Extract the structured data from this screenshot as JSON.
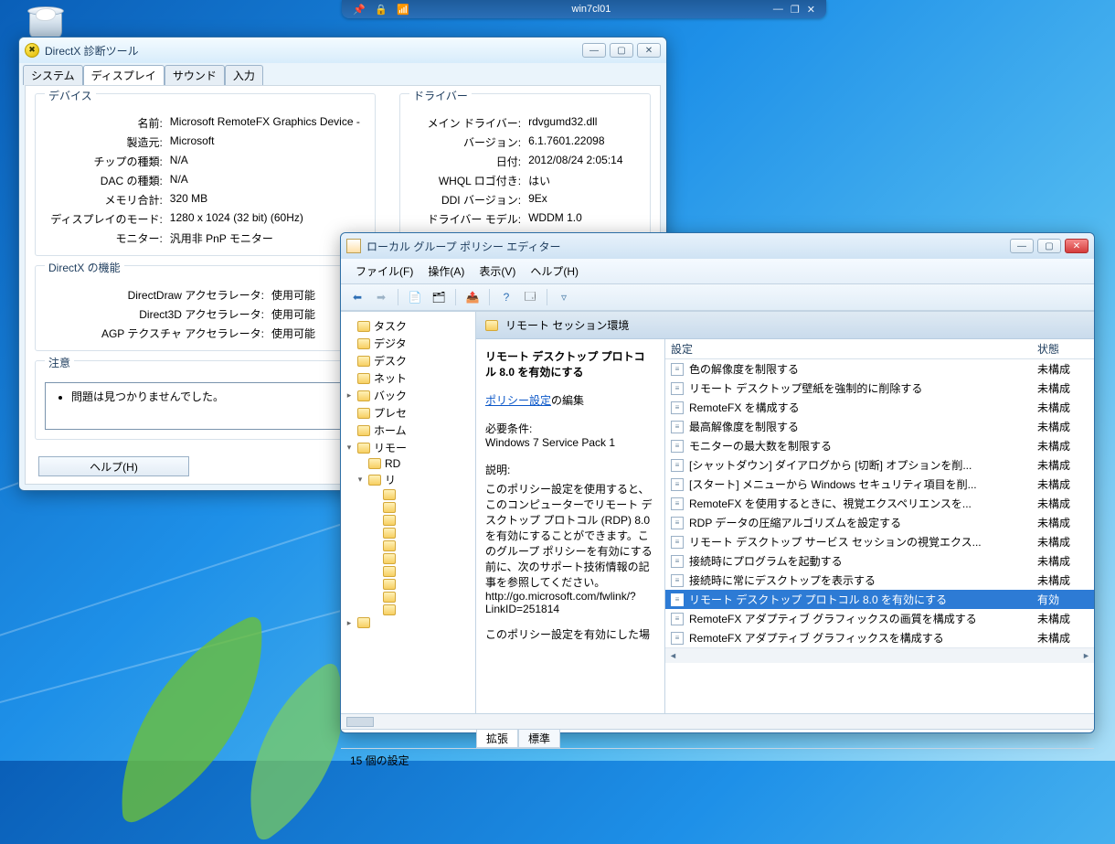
{
  "conn": {
    "title": "win7cl01"
  },
  "dxdiag": {
    "title": "DirectX 診断ツール",
    "tabs": [
      "システム",
      "ディスプレイ",
      "サウンド",
      "入力"
    ],
    "active_tab": 1,
    "device_label": "デバイス",
    "driver_label": "ドライバー",
    "dxfunc_label": "DirectX の機能",
    "notes_label": "注意",
    "device": [
      {
        "k": "名前:",
        "v": "Microsoft RemoteFX Graphics Device -"
      },
      {
        "k": "製造元:",
        "v": "Microsoft"
      },
      {
        "k": "チップの種類:",
        "v": "N/A"
      },
      {
        "k": "DAC の種類:",
        "v": "N/A"
      },
      {
        "k": "メモリ合計:",
        "v": "320 MB"
      },
      {
        "k": "ディスプレイのモード:",
        "v": "1280 x 1024 (32 bit) (60Hz)"
      },
      {
        "k": "モニター:",
        "v": "汎用非 PnP モニター"
      }
    ],
    "driver": [
      {
        "k": "メイン ドライバー:",
        "v": "rdvgumd32.dll"
      },
      {
        "k": "バージョン:",
        "v": "6.1.7601.22098"
      },
      {
        "k": "日付:",
        "v": "2012/08/24 2:05:14"
      },
      {
        "k": "WHQL ロゴ付き:",
        "v": "はい"
      },
      {
        "k": "DDI バージョン:",
        "v": "9Ex"
      },
      {
        "k": "ドライバー モデル:",
        "v": "WDDM 1.0"
      }
    ],
    "dxfunc": [
      {
        "k": "DirectDraw アクセラレータ:",
        "v": "使用可能"
      },
      {
        "k": "Direct3D アクセラレータ:",
        "v": "使用可能"
      },
      {
        "k": "AGP テクスチャ アクセラレータ:",
        "v": "使用可能"
      }
    ],
    "note_text": "問題は見つかりませんでした。",
    "help_btn": "ヘルプ(H)"
  },
  "gpedit": {
    "title": "ローカル グループ ポリシー エディター",
    "menus": [
      "ファイル(F)",
      "操作(A)",
      "表示(V)",
      "ヘルプ(H)"
    ],
    "tree": [
      {
        "indent": 0,
        "exp": "",
        "label": "タスク"
      },
      {
        "indent": 0,
        "exp": "",
        "label": "デジタ"
      },
      {
        "indent": 0,
        "exp": "",
        "label": "デスク"
      },
      {
        "indent": 0,
        "exp": "",
        "label": "ネット"
      },
      {
        "indent": 0,
        "exp": "▸",
        "label": "バック"
      },
      {
        "indent": 0,
        "exp": "",
        "label": "プレセ"
      },
      {
        "indent": 0,
        "exp": "",
        "label": "ホーム"
      },
      {
        "indent": 0,
        "exp": "▾",
        "label": "リモー"
      },
      {
        "indent": 1,
        "exp": "",
        "label": "RD"
      },
      {
        "indent": 1,
        "exp": "▾",
        "label": "リ"
      },
      {
        "indent": 2,
        "exp": "",
        "label": ""
      },
      {
        "indent": 2,
        "exp": "",
        "label": ""
      },
      {
        "indent": 2,
        "exp": "",
        "label": ""
      },
      {
        "indent": 2,
        "exp": "",
        "label": ""
      },
      {
        "indent": 2,
        "exp": "",
        "label": ""
      },
      {
        "indent": 2,
        "exp": "",
        "label": ""
      },
      {
        "indent": 2,
        "exp": "",
        "label": ""
      },
      {
        "indent": 2,
        "exp": "",
        "label": ""
      },
      {
        "indent": 2,
        "exp": "",
        "label": ""
      },
      {
        "indent": 2,
        "exp": "",
        "label": ""
      },
      {
        "indent": 0,
        "exp": "▸",
        "label": ""
      }
    ],
    "detail_header": "リモート セッション環境",
    "selected_policy": "リモート デスクトップ プロトコル 8.0 を有効にする",
    "policy_link": "ポリシー設定",
    "policy_link_suffix": "の編集",
    "req_label": "必要条件:",
    "req_text": "Windows 7 Service Pack 1",
    "desc_label": "説明:",
    "desc_text": "このポリシー設定を使用すると、このコンピューターでリモート デスクトップ プロトコル (RDP) 8.0 を有効にすることができます。このグループ ポリシーを有効にする前に、次のサポート技術情報の記事を参照してください。http://go.microsoft.com/fwlink/?LinkID=251814",
    "desc_text2": "このポリシー設定を有効にした場",
    "col_setting": "設定",
    "col_state": "状態",
    "policies": [
      {
        "name": "色の解像度を制限する",
        "state": "未構成",
        "sel": false
      },
      {
        "name": "リモート デスクトップ壁紙を強制的に削除する",
        "state": "未構成",
        "sel": false
      },
      {
        "name": "RemoteFX を構成する",
        "state": "未構成",
        "sel": false
      },
      {
        "name": "最高解像度を制限する",
        "state": "未構成",
        "sel": false
      },
      {
        "name": "モニターの最大数を制限する",
        "state": "未構成",
        "sel": false
      },
      {
        "name": "[シャットダウン] ダイアログから [切断] オプションを削...",
        "state": "未構成",
        "sel": false
      },
      {
        "name": "[スタート] メニューから Windows セキュリティ項目を削...",
        "state": "未構成",
        "sel": false
      },
      {
        "name": "RemoteFX を使用するときに、視覚エクスペリエンスを...",
        "state": "未構成",
        "sel": false
      },
      {
        "name": "RDP データの圧縮アルゴリズムを設定する",
        "state": "未構成",
        "sel": false
      },
      {
        "name": "リモート デスクトップ サービス セッションの視覚エクス...",
        "state": "未構成",
        "sel": false
      },
      {
        "name": "接続時にプログラムを起動する",
        "state": "未構成",
        "sel": false
      },
      {
        "name": "接続時に常にデスクトップを表示する",
        "state": "未構成",
        "sel": false
      },
      {
        "name": "リモート デスクトップ プロトコル 8.0 を有効にする",
        "state": "有効",
        "sel": true
      },
      {
        "name": "RemoteFX アダプティブ グラフィックスの画質を構成する",
        "state": "未構成",
        "sel": false
      },
      {
        "name": "RemoteFX アダプティブ グラフィックスを構成する",
        "state": "未構成",
        "sel": false
      }
    ],
    "dtabs": [
      "拡張",
      "標準"
    ],
    "status": "15 個の設定"
  }
}
